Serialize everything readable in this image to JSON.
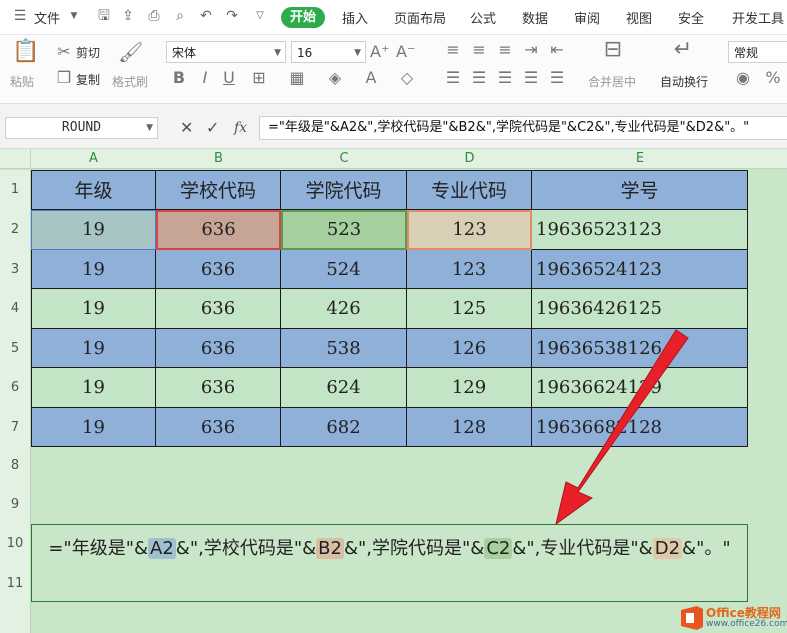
{
  "menubar": {
    "file_label": "文件",
    "tabs": [
      "开始",
      "插入",
      "页面布局",
      "公式",
      "数据",
      "审阅",
      "视图",
      "安全",
      "开发工具"
    ]
  },
  "ribbon": {
    "paste": "粘贴",
    "cut": "剪切",
    "copy": "复制",
    "format_painter": "格式刷",
    "font_name": "宋体",
    "font_size": "16",
    "merge_center": "合并居中",
    "wrap_text": "自动换行",
    "number_format": "常规",
    "icons": [
      "menu-icon",
      "save-icon",
      "undo-icon",
      "redo-icon",
      "bold-icon",
      "italic-icon",
      "underline-icon",
      "border-icon",
      "fill-color-icon",
      "font-color-icon",
      "clear-icon",
      "align-icon"
    ]
  },
  "formula_bar": {
    "name_box": "ROUND",
    "fx": "fx",
    "formula": "=\"年级是\"&A2&\",学校代码是\"&B2&\",学院代码是\"&C2&\",专业代码是\"&D2&\"。\""
  },
  "grid": {
    "columns": [
      "A",
      "B",
      "C",
      "D",
      "E"
    ],
    "rows": [
      "1",
      "2",
      "3",
      "4",
      "5",
      "6",
      "7",
      "8",
      "9",
      "10",
      "11"
    ],
    "header_row": [
      "年级",
      "学校代码",
      "学院代码",
      "专业代码",
      "学号"
    ],
    "data_rows": [
      [
        "19",
        "636",
        "523",
        "123",
        "19636523123"
      ],
      [
        "19",
        "636",
        "524",
        "123",
        "19636524123"
      ],
      [
        "19",
        "636",
        "426",
        "125",
        "19636426125"
      ],
      [
        "19",
        "636",
        "538",
        "126",
        "19636538126"
      ],
      [
        "19",
        "636",
        "624",
        "129",
        "19636624129"
      ],
      [
        "19",
        "636",
        "682",
        "128",
        "19636682128"
      ]
    ]
  },
  "edit_cell": {
    "p1": "=\"年级是\"&",
    "ref_a": "A2",
    "p2": "&\",学校代码是\"&",
    "ref_b": "B2",
    "p3": "&\",学院代码是\"&",
    "ref_c": "C2",
    "p4": "&\",专业代码是\"&",
    "ref_d": "D2",
    "p5": "&\"。\""
  },
  "watermark": {
    "name": "Office教程网",
    "site": "www.office26.com"
  },
  "colors": {
    "accent_green": "#2dab4d",
    "row_blue": "#8fb0d8",
    "row_green": "#c4e4c6",
    "arrow_red": "#e8202a"
  }
}
